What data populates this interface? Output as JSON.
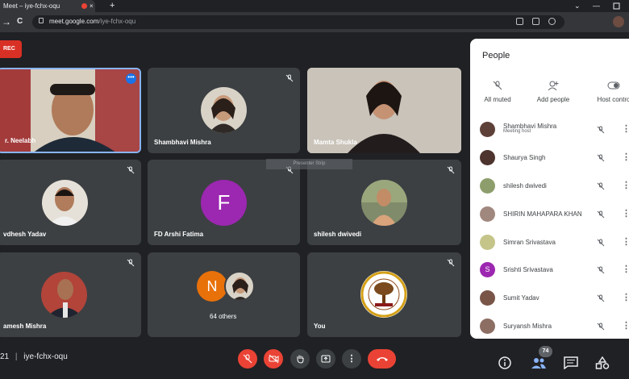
{
  "browser": {
    "tab_title": "Meet – iye-fchx-oqu",
    "tab_close": "×",
    "new_tab": "+",
    "url_host": "meet.google.com",
    "url_path": "/iye-fchx-oqu",
    "back": "←",
    "forward": "→",
    "reload": "C",
    "chevron": "⌄",
    "minimize": "—",
    "menu": "⋮"
  },
  "rec_label": "REC",
  "tiles": [
    {
      "name": "r. Neelabh",
      "more": "•••"
    },
    {
      "name": "Shambhavi Mishra"
    },
    {
      "name": "Mamta Shukla"
    },
    {
      "name": "vdhesh Yadav"
    },
    {
      "name": "FD Arshi Fatima",
      "initial": "F"
    },
    {
      "name": "shilesh dwivedi"
    },
    {
      "name": "amesh Mishra"
    },
    {
      "name": "",
      "initial": "N",
      "others_label": "64 others"
    },
    {
      "name": "You"
    }
  ],
  "tooltip": "Presenter Strip",
  "people_panel": {
    "title": "People",
    "actions": [
      {
        "label": "All muted",
        "icon": "mic-off-icon"
      },
      {
        "label": "Add people",
        "icon": "add-person-icon"
      },
      {
        "label": "Host contro",
        "icon": "toggle-icon"
      }
    ],
    "participants": [
      {
        "name": "Shambhavi Mishra",
        "subtitle": "Meeting host",
        "avatar_color": "#5d4037"
      },
      {
        "name": "Shaurya Singh",
        "subtitle": "",
        "avatar_color": "#4e342e"
      },
      {
        "name": "shilesh dwivedi",
        "subtitle": "",
        "avatar_color": "#8d9e6c"
      },
      {
        "name": "SHIRIN MAHAPARA KHAN",
        "subtitle": "",
        "avatar_color": "#a1887f"
      },
      {
        "name": "Simran Srivastava",
        "subtitle": "",
        "avatar_color": "#c5c58a"
      },
      {
        "name": "Srishti Srivastava",
        "subtitle": "",
        "initial": "S",
        "avatar_color": "#9c27b0"
      },
      {
        "name": "Sumit Yadav",
        "subtitle": "",
        "avatar_color": "#795548"
      },
      {
        "name": "Suryansh Mishra",
        "subtitle": "",
        "avatar_color": "#8d6e63"
      }
    ],
    "kebab": "⋮"
  },
  "bottom_bar": {
    "time_fragment": "21",
    "separator": "|",
    "meeting_code": "iye-fchx-oqu",
    "participant_count": "74"
  },
  "colors": {
    "background": "#202124",
    "tile": "#3c4043",
    "end_call": "#ea4335",
    "accent_blue": "#1a73e8",
    "avatar_purple": "#9c27b0",
    "avatar_orange": "#e8710a"
  }
}
